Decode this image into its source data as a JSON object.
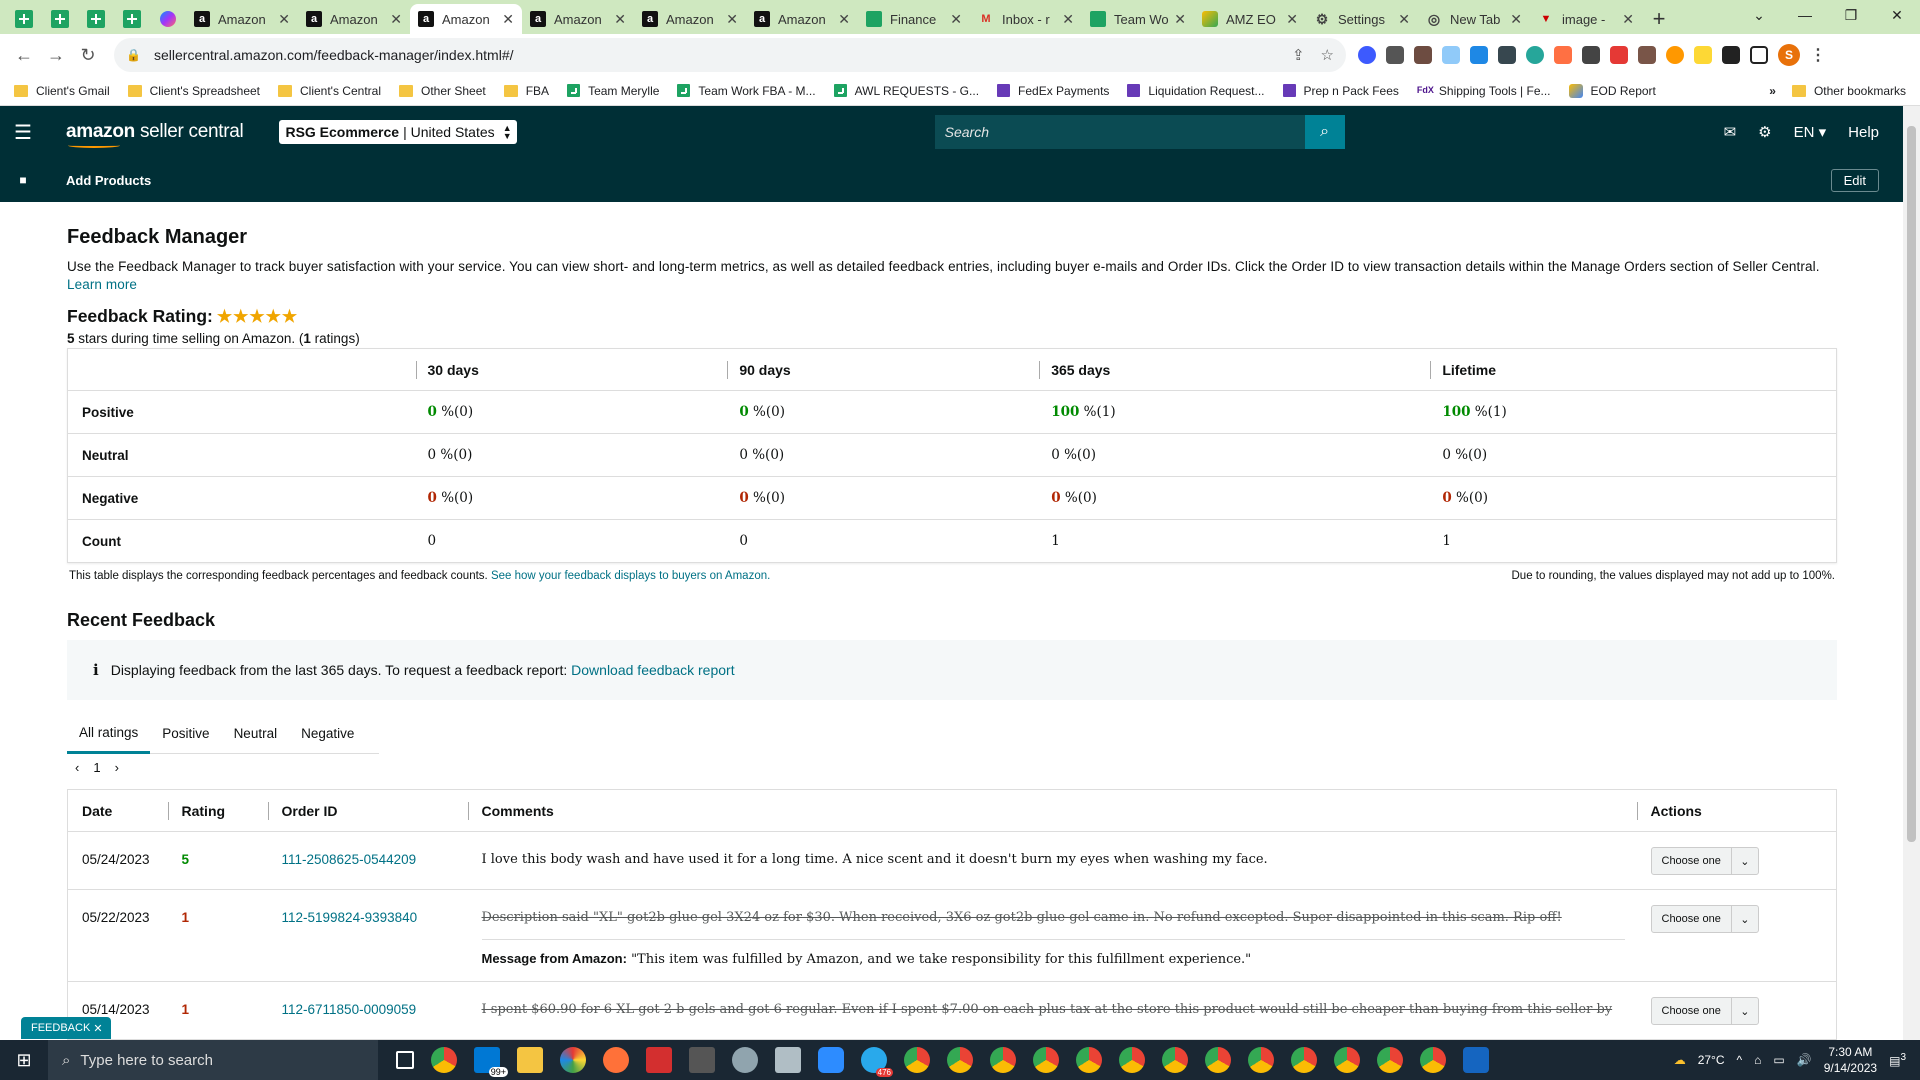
{
  "browser": {
    "tabs": [
      {
        "label": "Amazon",
        "icon": "amazon-icon",
        "active": false
      },
      {
        "label": "Amazon",
        "icon": "amazon-icon",
        "active": false
      },
      {
        "label": "Amazon",
        "icon": "amazon-icon",
        "active": true
      },
      {
        "label": "Amazon",
        "icon": "amazon-icon",
        "active": false
      },
      {
        "label": "Amazon",
        "icon": "amazon-icon",
        "active": false
      },
      {
        "label": "Amazon",
        "icon": "amazon-icon",
        "active": false
      },
      {
        "label": "Finance",
        "icon": "sheets-icon",
        "active": false
      },
      {
        "label": "Inbox - r",
        "icon": "gmail-icon",
        "active": false
      },
      {
        "label": "Team Wo",
        "icon": "sheets-icon",
        "active": false
      },
      {
        "label": "AMZ EO",
        "icon": "app-icon",
        "active": false
      },
      {
        "label": "Settings",
        "icon": "gear-icon",
        "active": false
      },
      {
        "label": "New Tab",
        "icon": "globe-icon",
        "active": false
      },
      {
        "label": "image -",
        "icon": "image-icon",
        "active": false
      }
    ],
    "url": "sellercentral.amazon.com/feedback-manager/index.html#/",
    "profile_initial": "S",
    "bookmarks": [
      {
        "label": "Client's Gmail",
        "icon": "folder"
      },
      {
        "label": "Client's Spreadsheet",
        "icon": "folder"
      },
      {
        "label": "Client's Central",
        "icon": "folder"
      },
      {
        "label": "Other Sheet",
        "icon": "folder"
      },
      {
        "label": "FBA",
        "icon": "folder"
      },
      {
        "label": "Team Merylle",
        "icon": "sheet"
      },
      {
        "label": "Team Work FBA - M...",
        "icon": "sheet"
      },
      {
        "label": "AWL REQUESTS - G...",
        "icon": "sheet"
      },
      {
        "label": "FedEx Payments",
        "icon": "form"
      },
      {
        "label": "Liquidation Request...",
        "icon": "form"
      },
      {
        "label": "Prep n Pack Fees",
        "icon": "form"
      },
      {
        "label": "Shipping Tools | Fe...",
        "icon": "fedex"
      },
      {
        "label": "EOD Report",
        "icon": "eod"
      }
    ],
    "more_bookmarks": "»",
    "other_bookmarks": "Other bookmarks"
  },
  "header": {
    "logo_main": "amazon",
    "logo_sub": "seller central",
    "account_name": "RSG Ecommerce",
    "account_region": "| United States",
    "search_placeholder": "Search",
    "language": "EN",
    "help": "Help",
    "add_products": "Add Products",
    "edit": "Edit"
  },
  "page": {
    "title": "Feedback Manager",
    "intro": "Use the Feedback Manager to track buyer satisfaction with your service. You can view short- and long-term metrics, as well as detailed feedback entries, including buyer e-mails and Order IDs. Click the Order ID to view transaction details within the Manage Orders section of Seller Central.",
    "learn_more": "Learn more",
    "rating_label": "Feedback Rating:",
    "rating_stars": 5,
    "rating_stars_glyph": "★★★★★",
    "rating_sub_stars": "5",
    "rating_sub_mid": "stars during time selling on Amazon. (",
    "rating_count": "1",
    "rating_sub_end": "ratings)",
    "metrics": {
      "columns": [
        "",
        "30 days",
        "90 days",
        "365 days",
        "Lifetime"
      ],
      "rows": [
        {
          "label": "Positive",
          "type": "pos",
          "cells": [
            {
              "v": "0",
              "p": "%(0)"
            },
            {
              "v": "0",
              "p": "%(0)"
            },
            {
              "v": "100",
              "p": "%(1)"
            },
            {
              "v": "100",
              "p": "%(1)"
            }
          ]
        },
        {
          "label": "Neutral",
          "type": "neu",
          "cells": [
            {
              "v": "0",
              "p": "%(0)"
            },
            {
              "v": "0",
              "p": "%(0)"
            },
            {
              "v": "0",
              "p": "%(0)"
            },
            {
              "v": "0",
              "p": "%(0)"
            }
          ]
        },
        {
          "label": "Negative",
          "type": "neg",
          "cells": [
            {
              "v": "0",
              "p": "%(0)"
            },
            {
              "v": "0",
              "p": "%(0)"
            },
            {
              "v": "0",
              "p": "%(0)"
            },
            {
              "v": "0",
              "p": "%(0)"
            }
          ]
        },
        {
          "label": "Count",
          "type": "cnt",
          "cells": [
            {
              "v": "0",
              "p": ""
            },
            {
              "v": "0",
              "p": ""
            },
            {
              "v": "1",
              "p": ""
            },
            {
              "v": "1",
              "p": ""
            }
          ]
        }
      ],
      "note_left": "This table displays the corresponding feedback percentages and feedback counts.",
      "note_link": "See how your feedback displays to buyers on Amazon.",
      "note_right": "Due to rounding, the values displayed may not add up to 100%."
    },
    "recent_title": "Recent Feedback",
    "info_text": "Displaying feedback from the last 365 days. To request a feedback report:",
    "info_link": "Download feedback report",
    "filter_tabs": [
      "All ratings",
      "Positive",
      "Neutral",
      "Negative"
    ],
    "page_number": "1",
    "feedback_columns": [
      "Date",
      "Rating",
      "Order ID",
      "Comments",
      "Actions"
    ],
    "feedback_rows": [
      {
        "date": "05/24/2023",
        "rating": "5",
        "order": "111-2508625-0544209",
        "comment": "I love this body wash and have used it for a long time. A nice scent and it doesn't burn my eyes when washing my face.",
        "struck": false,
        "message_label": "",
        "message": "",
        "action": "Choose one"
      },
      {
        "date": "05/22/2023",
        "rating": "1",
        "order": "112-5199824-9393840",
        "comment": "Description said \"XL\" got2b glue gel 3X24 oz for $30. When received, 3X6 oz got2b glue gel came in. No refund excepted. Super disappointed in this scam. Rip off!",
        "struck": true,
        "message_label": "Message from Amazon:",
        "message": "\"This item was fulfilled by Amazon, and we take responsibility for this fulfillment experience.\"",
        "action": "Choose one"
      },
      {
        "date": "05/14/2023",
        "rating": "1",
        "order": "112-6711850-0009059",
        "comment": "I spent $60.90 for 6 XL got 2 b gels and got 6 regular. Even if I spent $7.00 on each plus tax at the store this product would still be cheaper than buying from this seller by",
        "struck": true,
        "message_label": "",
        "message": "",
        "action": "Choose one"
      }
    ],
    "feedback_tab": "FEEDBACK"
  },
  "taskbar": {
    "search_placeholder": "Type here to search",
    "badge": "99+",
    "telegram_badge": "476",
    "weather": "27°C",
    "time": "7:30 AM",
    "date": "9/14/2023",
    "notifications": "3"
  }
}
